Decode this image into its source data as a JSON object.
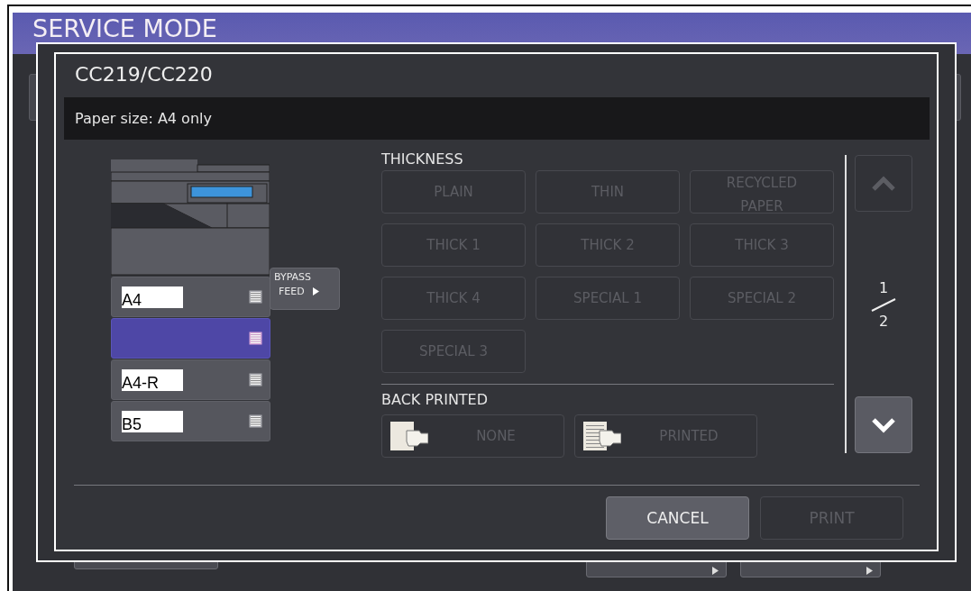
{
  "screen": {
    "title": "SERVICE MODE"
  },
  "dialog": {
    "title": "CC219/CC220",
    "message": "Paper size: A4 only",
    "trays": [
      {
        "label": "A4",
        "selected": false
      },
      {
        "selected": true
      },
      {
        "label": "A4-R",
        "selected": false
      },
      {
        "label": "B5",
        "selected": false
      }
    ],
    "bypass": {
      "label_line_1": "BYPASS",
      "label_line_2": "FEED"
    },
    "thickness": {
      "label": "THICKNESS",
      "options": [
        {
          "label": "PLAIN",
          "disabled": true
        },
        {
          "label": "THIN",
          "disabled": true
        },
        {
          "label": "RECYCLED PAPER",
          "disabled": true
        },
        {
          "label": "THICK 1",
          "disabled": true
        },
        {
          "label": "THICK 2",
          "disabled": true
        },
        {
          "label": "THICK 3",
          "disabled": true
        },
        {
          "label": "THICK 4",
          "disabled": true
        },
        {
          "label": "SPECIAL 1",
          "disabled": true
        },
        {
          "label": "SPECIAL 2",
          "disabled": true
        },
        {
          "label": "SPECIAL 3",
          "disabled": true
        }
      ]
    },
    "back_printed": {
      "label": "BACK PRINTED",
      "options": [
        {
          "label": "NONE",
          "kind": "blank",
          "disabled": true
        },
        {
          "label": "PRINTED",
          "kind": "printed",
          "disabled": true
        }
      ]
    },
    "pager": {
      "current": "1",
      "total": "2",
      "up_disabled": true,
      "down_disabled": false
    },
    "buttons": [
      {
        "label": "CANCEL",
        "disabled": false
      },
      {
        "label": "PRINT",
        "disabled": true
      }
    ]
  }
}
